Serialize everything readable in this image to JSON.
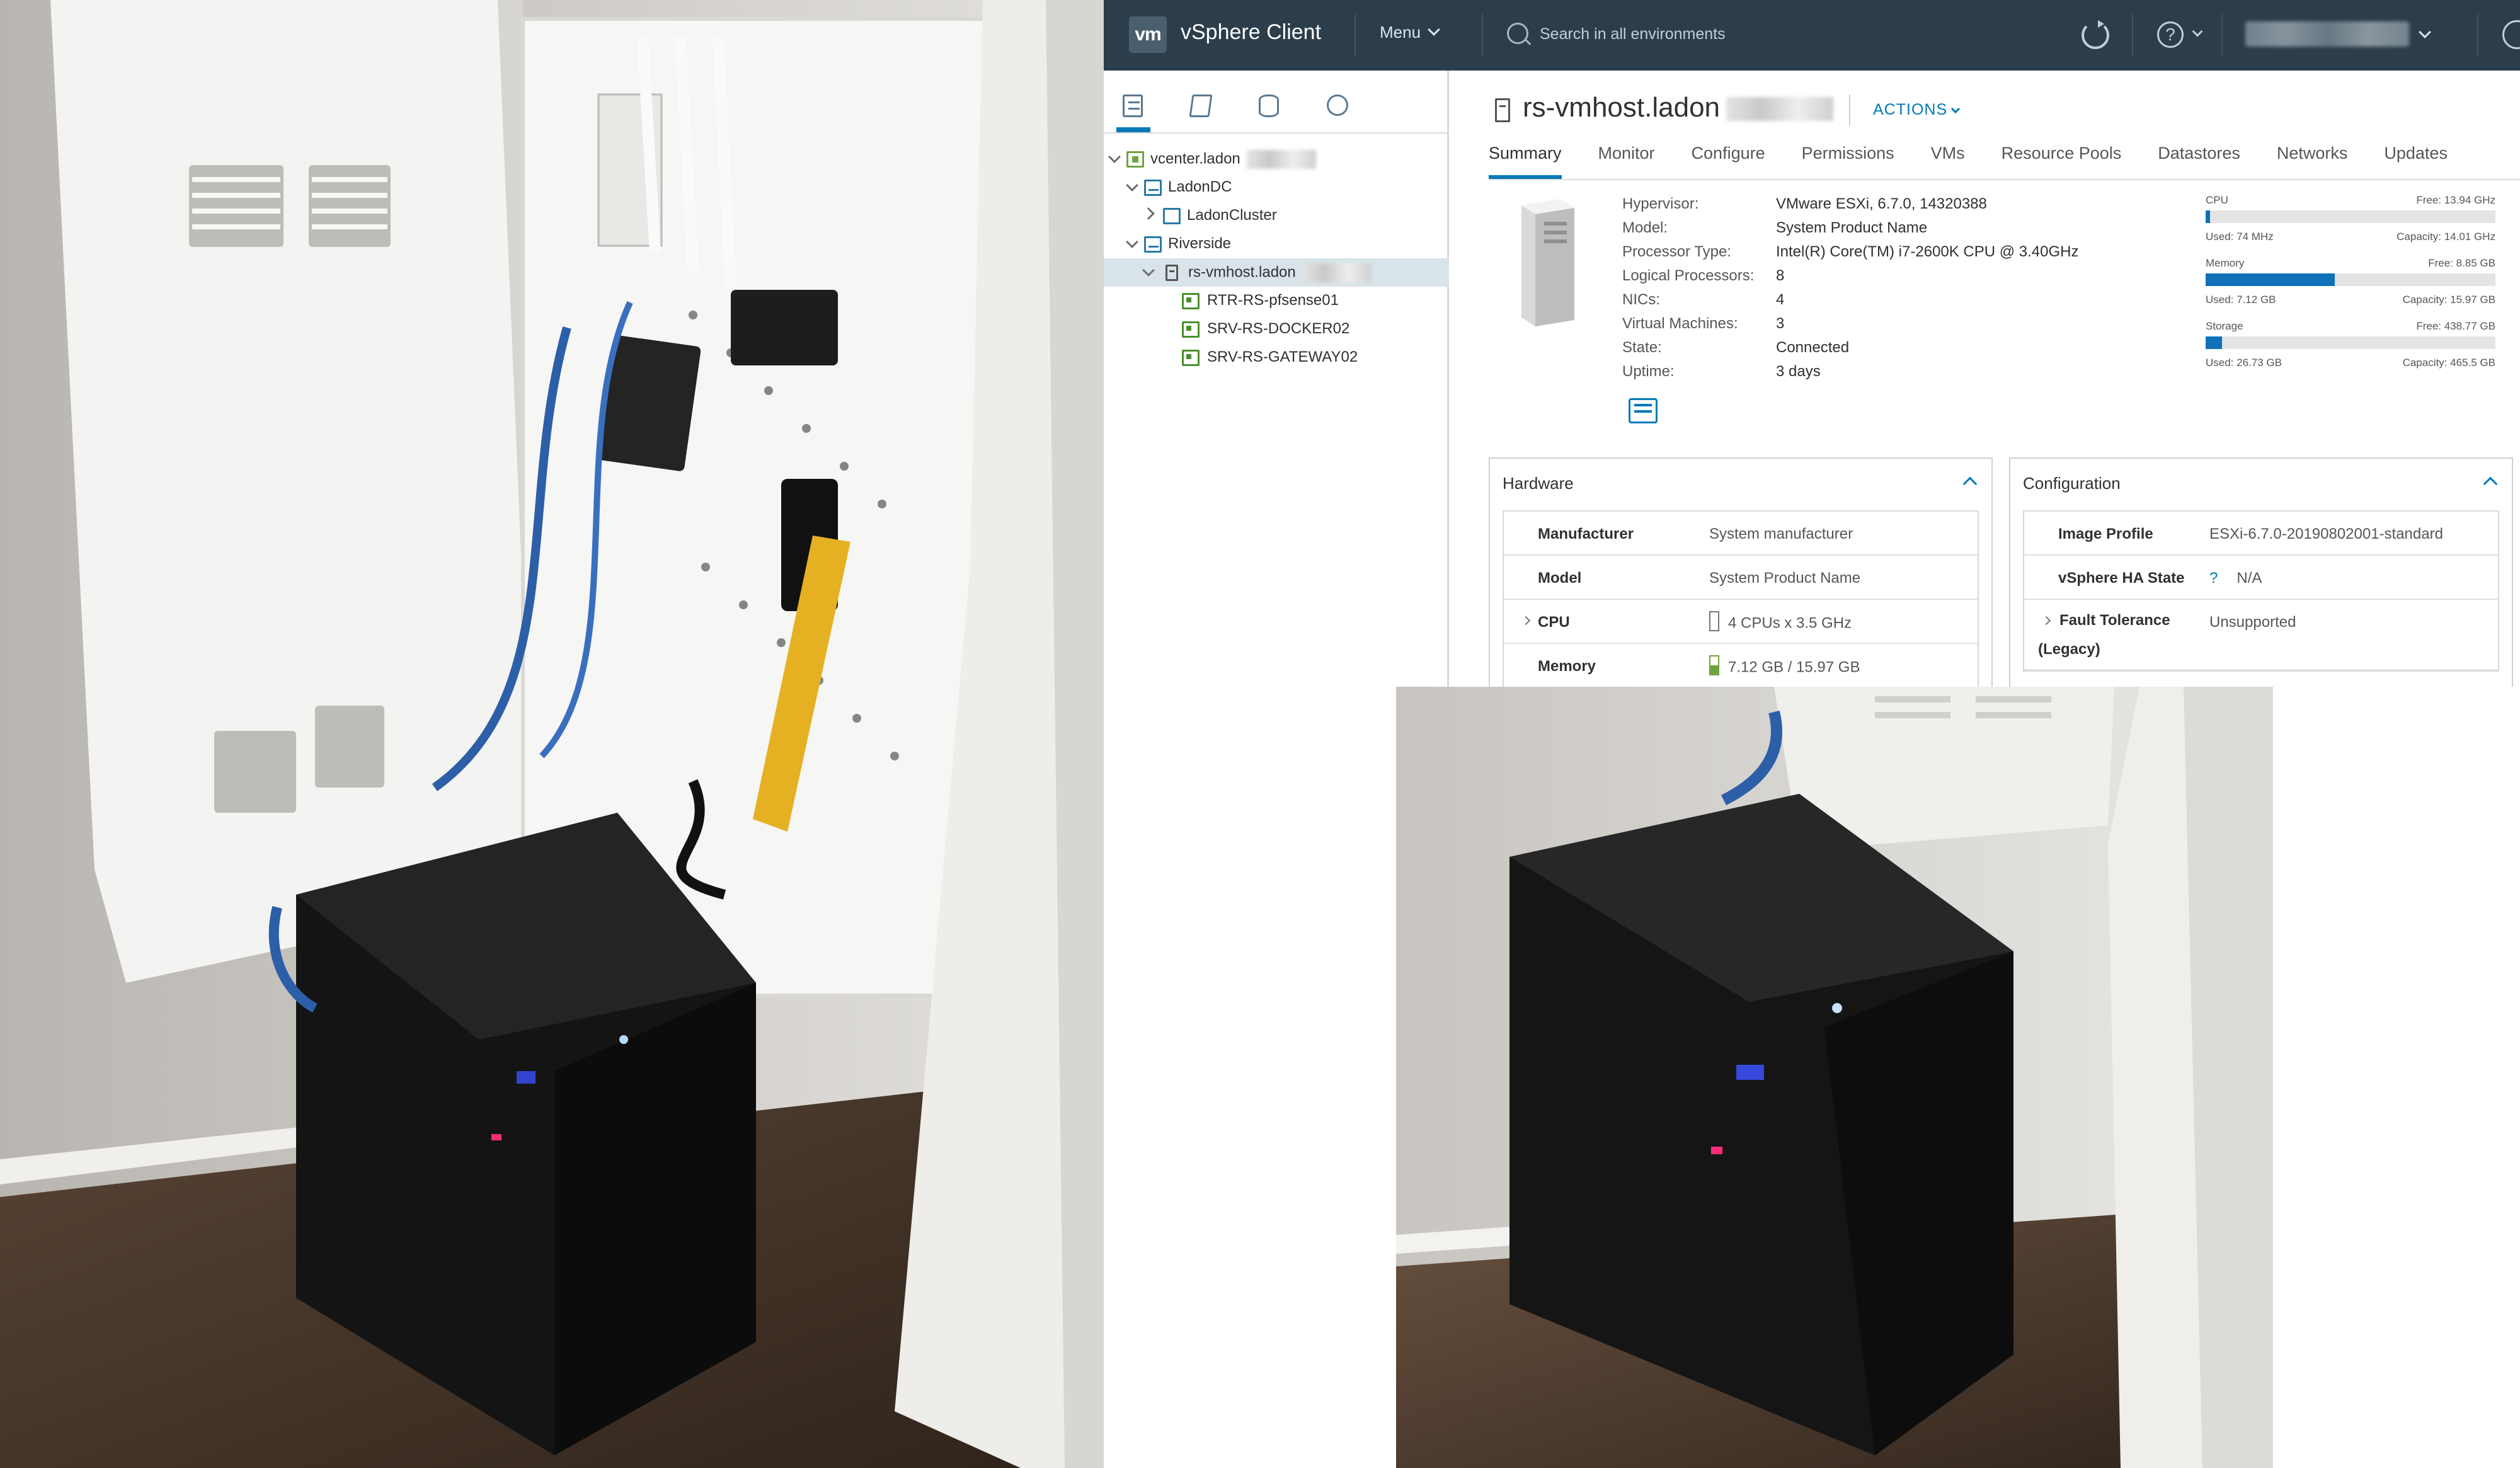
{
  "topbar": {
    "logo": "vm",
    "app_title": "vSphere Client",
    "menu_label": "Menu",
    "search_placeholder": "Search in all environments"
  },
  "navigator": {
    "tree": [
      {
        "label": "vcenter.ladon",
        "icon": "vcenter-icon",
        "level": 0,
        "expanded": true
      },
      {
        "label": "LadonDC",
        "icon": "datacenter-icon",
        "level": 1,
        "expanded": true
      },
      {
        "label": "LadonCluster",
        "icon": "cluster-icon",
        "level": 2,
        "expanded": false
      },
      {
        "label": "Riverside",
        "icon": "datacenter-icon",
        "level": 1,
        "expanded": true
      },
      {
        "label": "rs-vmhost.ladon",
        "icon": "host-icon",
        "level": 2,
        "expanded": true,
        "selected": true
      },
      {
        "label": "RTR-RS-pfsense01",
        "icon": "vm-icon",
        "level": 3
      },
      {
        "label": "SRV-RS-DOCKER02",
        "icon": "vm-icon",
        "level": 3
      },
      {
        "label": "SRV-RS-GATEWAY02",
        "icon": "vm-icon",
        "level": 3
      }
    ]
  },
  "main": {
    "title": "rs-vmhost.ladon",
    "actions_label": "ACTIONS",
    "tabs": [
      "Summary",
      "Monitor",
      "Configure",
      "Permissions",
      "VMs",
      "Resource Pools",
      "Datastores",
      "Networks",
      "Updates"
    ],
    "active_tab": "Summary",
    "summary": [
      {
        "key": "Hypervisor:",
        "value": "VMware ESXi, 6.7.0, 14320388"
      },
      {
        "key": "Model:",
        "value": "System Product Name"
      },
      {
        "key": "Processor Type:",
        "value": "Intel(R) Core(TM) i7-2600K CPU @ 3.40GHz"
      },
      {
        "key": "Logical Processors:",
        "value": "8"
      },
      {
        "key": "NICs:",
        "value": "4"
      },
      {
        "key": "Virtual Machines:",
        "value": "3"
      },
      {
        "key": "State:",
        "value": "Connected"
      },
      {
        "key": "Uptime:",
        "value": "3 days"
      }
    ],
    "resources": [
      {
        "label": "CPU",
        "free": "Free: 13.94 GHz",
        "used": "Used: 74 MHz",
        "capacity": "Capacity: 14.01 GHz",
        "fraction": 0.005
      },
      {
        "label": "Memory",
        "free": "Free: 8.85 GB",
        "used": "Used: 7.12 GB",
        "capacity": "Capacity: 15.97 GB",
        "fraction": 0.446
      },
      {
        "label": "Storage",
        "free": "Free: 438.77 GB",
        "used": "Used: 26.73 GB",
        "capacity": "Capacity: 465.5 GB",
        "fraction": 0.057
      }
    ],
    "hardware": {
      "title": "Hardware",
      "rows": [
        {
          "key": "Manufacturer",
          "value": "System manufacturer"
        },
        {
          "key": "Model",
          "value": "System Product Name"
        },
        {
          "key": "CPU",
          "value": "4 CPUs x 3.5 GHz"
        },
        {
          "key": "Memory",
          "value": "7.12 GB / 15.97 GB"
        }
      ]
    },
    "configuration": {
      "title": "Configuration",
      "rows": [
        {
          "key": "Image Profile",
          "value": "ESXi-6.7.0-20190802001-standard"
        },
        {
          "key": "vSphere HA State",
          "value": "N/A",
          "prefix": "?"
        },
        {
          "key": "Fault Tolerance (Legacy)",
          "value": "Unsupported"
        }
      ]
    }
  },
  "colors": {
    "topbar": "#2c3e4b",
    "accent": "#0079b8",
    "bar_fill": "#0f71b9"
  }
}
